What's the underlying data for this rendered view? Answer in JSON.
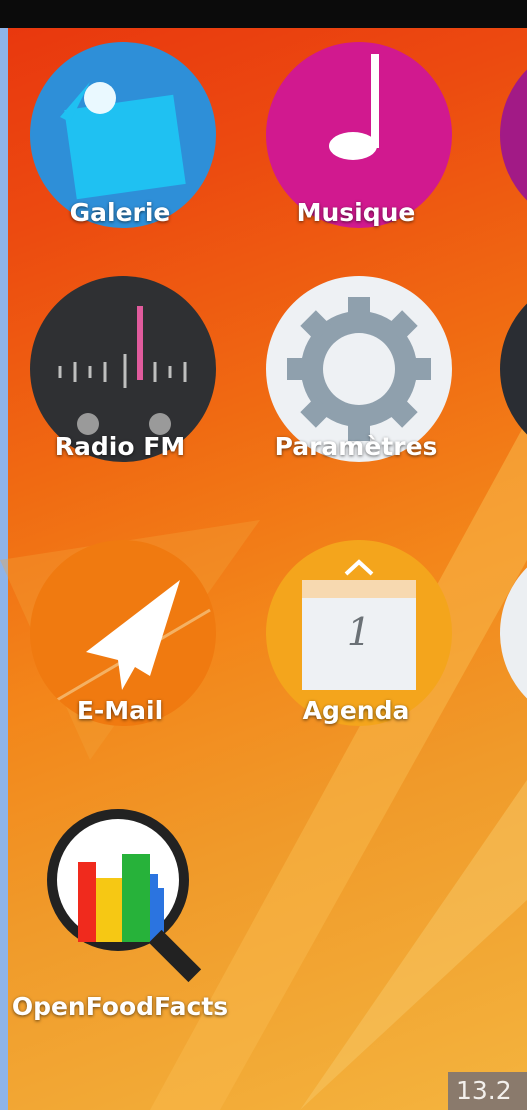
{
  "apps": [
    {
      "label": "Galerie",
      "icon": "gallery-icon"
    },
    {
      "label": "Musique",
      "icon": "music-icon"
    },
    {
      "label": "Radio FM",
      "icon": "radio-icon"
    },
    {
      "label": "Paramètres",
      "icon": "settings-gear-icon"
    },
    {
      "label": "E-Mail",
      "icon": "paper-plane-icon"
    },
    {
      "label": "Agenda",
      "icon": "calendar-icon"
    },
    {
      "label": "OpenFoodFacts",
      "icon": "openfoodfacts-icon"
    }
  ],
  "calendar_day": "1",
  "corner_badge": "13.2",
  "colors": {
    "gallery": "#2e8fd8",
    "music": "#d1198f",
    "radio": "#2f3033",
    "settings": "#eef1f4",
    "email": "#f07a10",
    "agenda": "#f4a51c"
  }
}
